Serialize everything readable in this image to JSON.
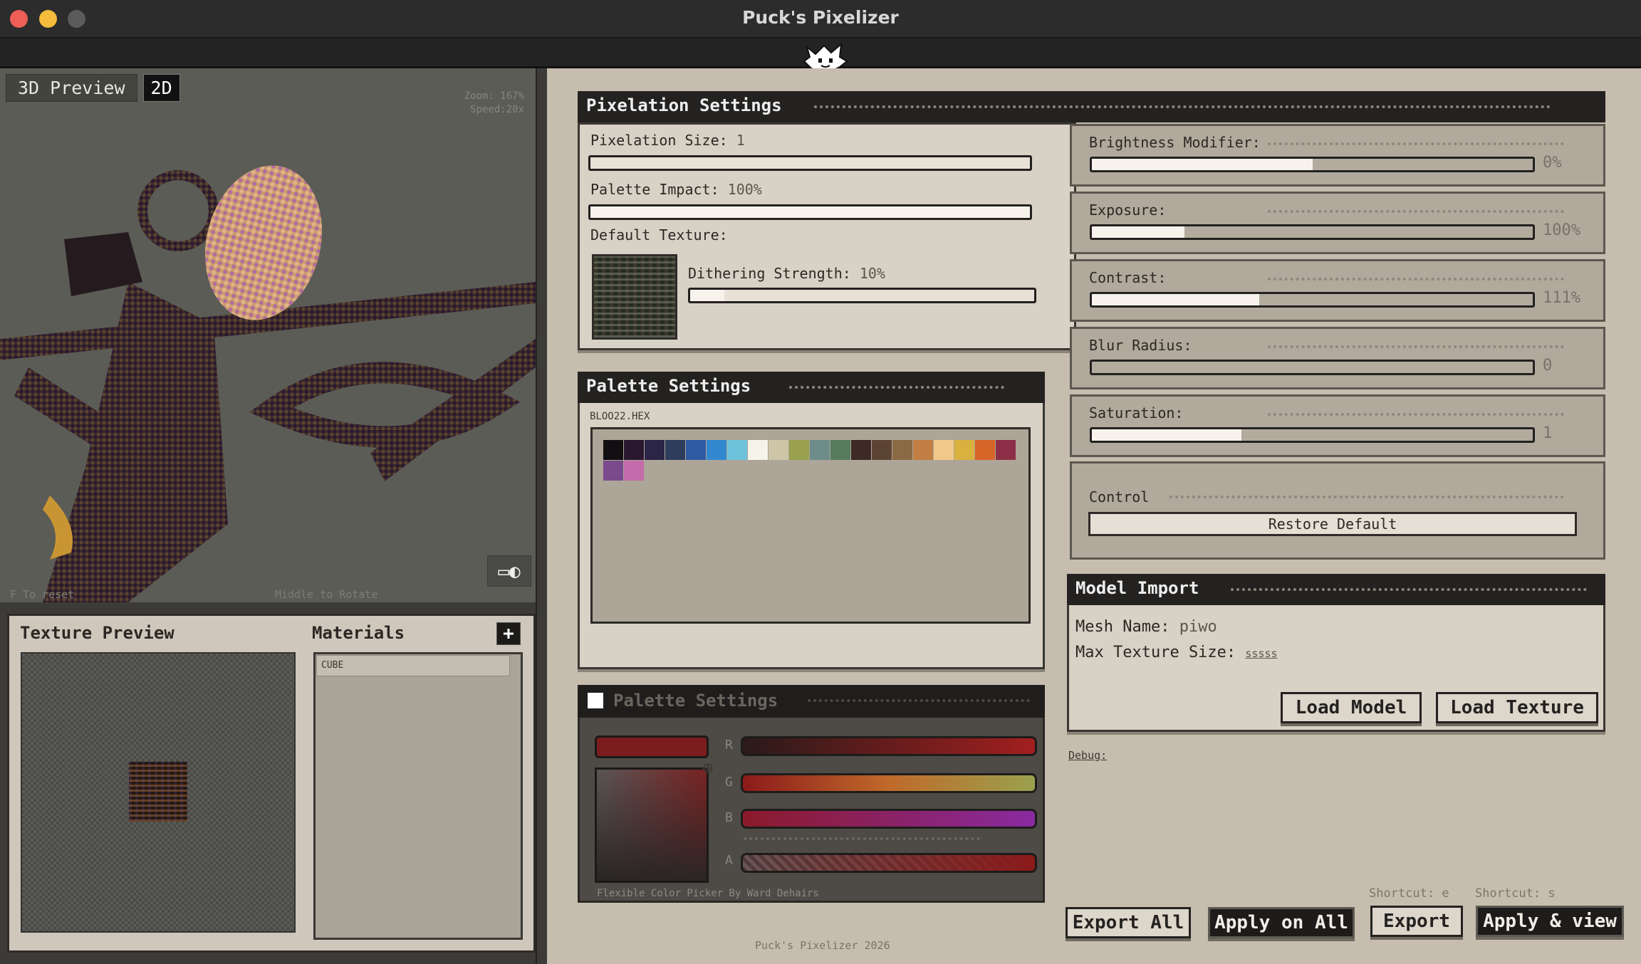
{
  "window": {
    "title": "Puck's Pixelizer"
  },
  "viewport": {
    "tabs": [
      "3D Preview",
      "2D"
    ],
    "zoom": "Zoom: 167%",
    "speed": "Speed:20x",
    "hint_left": "F To reset",
    "hint_mid": "Middle to Rotate",
    "view_icon": "camera-toggle-icon"
  },
  "texture_preview": {
    "title": "Texture Preview"
  },
  "materials": {
    "title": "Materials",
    "add_label": "+",
    "items": [
      "CUBE"
    ]
  },
  "pixelation": {
    "title": "Pixelation Settings",
    "size": {
      "label": "Pixelation Size:",
      "value": "1",
      "fraction": 0.0
    },
    "palette_impact": {
      "label": "Palette Impact:",
      "value": "100%",
      "fraction": 1.0
    },
    "default_texture_label": "Default Texture:",
    "dithering": {
      "label": "Dithering Strength:",
      "value": "10%",
      "fraction": 0.1
    }
  },
  "adjustments": [
    {
      "label": "Brightness Modifier:",
      "value": "0%",
      "fraction": 0.5
    },
    {
      "label": "Exposure:",
      "value": "100%",
      "fraction": 0.21
    },
    {
      "label": "Contrast:",
      "value": "111%",
      "fraction": 0.38
    },
    {
      "label": "Blur Radius:",
      "value": "0",
      "fraction": 0.0
    },
    {
      "label": "Saturation:",
      "value": "1",
      "fraction": 0.34
    }
  ],
  "control": {
    "title": "Control",
    "restore_label": "Restore Default"
  },
  "palette": {
    "title": "Palette Settings",
    "file": "BLOO22.HEX",
    "colors": [
      "#120f12",
      "#2a1730",
      "#2b2547",
      "#2e3d5c",
      "#2e5aa3",
      "#3288cf",
      "#6ec3dc",
      "#f5f3ea",
      "#cfc6a8",
      "#9aa14e",
      "#6e8c8a",
      "#557a5e",
      "#3d2a27",
      "#5c4433",
      "#8a6a42",
      "#c27e43",
      "#f2c98a",
      "#d8b13f",
      "#d86528",
      "#8c2f46",
      "#7a4a8c",
      "#c46bab"
    ]
  },
  "picker": {
    "title": "Palette Settings",
    "channels": [
      "R",
      "G",
      "B",
      "A"
    ],
    "credit": "Flexible Color Picker By Ward Dehairs"
  },
  "model_import": {
    "title": "Model Import",
    "mesh_label": "Mesh Name:",
    "mesh_value": "piwo",
    "max_tex_label": "Max Texture Size:",
    "max_tex_value": "sssss",
    "load_model": "Load Model",
    "load_texture": "Load Texture"
  },
  "debug": "Debug:",
  "actions": {
    "export_all": "Export All",
    "apply_all": "Apply on All",
    "export": "Export",
    "apply_view": "Apply & view",
    "shortcut_e": "Shortcut: e",
    "shortcut_s": "Shortcut: s"
  },
  "footer": "Puck's Pixelizer 2026"
}
